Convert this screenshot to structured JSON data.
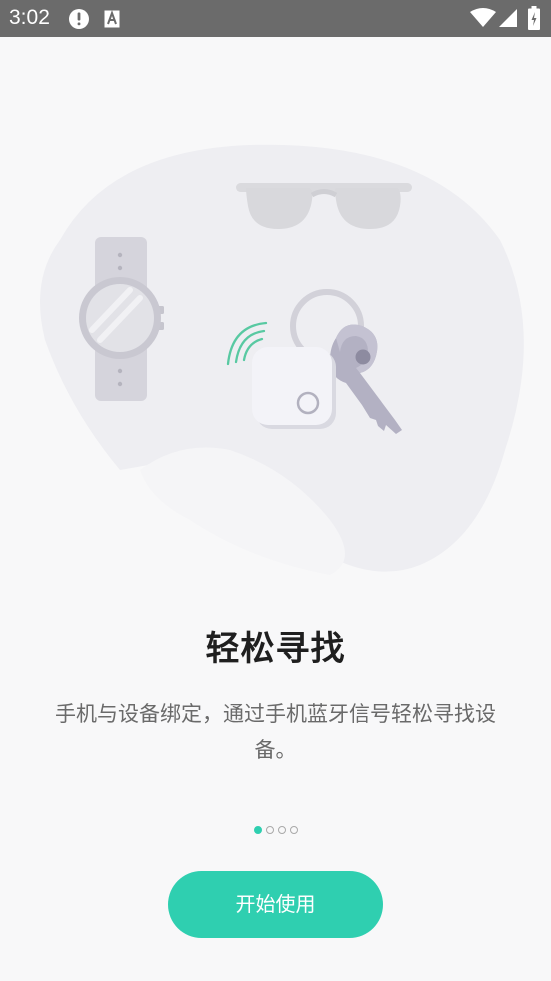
{
  "status_bar": {
    "time": "3:02",
    "icons": [
      "alert-icon",
      "keyboard-a-icon",
      "wifi-icon",
      "signal-icon",
      "battery-charging-icon"
    ]
  },
  "onboarding": {
    "title": "轻松寻找",
    "description": "手机与设备绑定，通过手机蓝牙信号轻松寻找设备。",
    "pager": {
      "total": 4,
      "active_index": 0
    },
    "start_button_label": "开始使用"
  },
  "colors": {
    "accent": "#2fcfb0",
    "status_bar": "#6b6b6b",
    "background": "#f8f8f9",
    "title": "#1f1f1f",
    "description": "#6a6a6a"
  }
}
